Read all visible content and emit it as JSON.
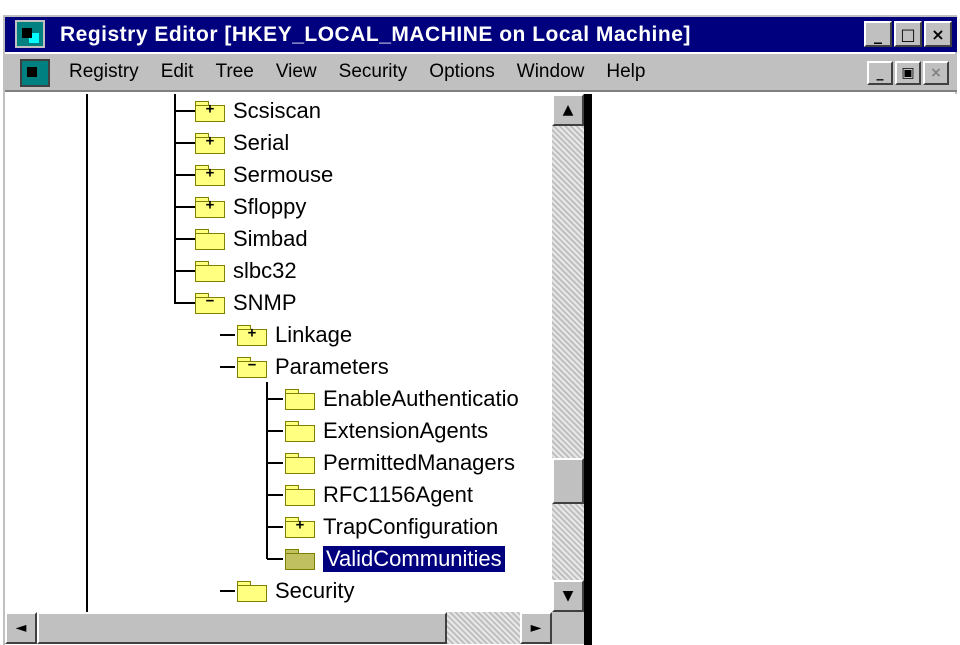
{
  "window": {
    "title": "Registry Editor   [HKEY_LOCAL_MACHINE on Local Machine]",
    "caption_buttons": {
      "minimize": "_",
      "maximize": "□",
      "close": "×"
    }
  },
  "menu": {
    "items": [
      "Registry",
      "Edit",
      "Tree",
      "View",
      "Security",
      "Options",
      "Window",
      "Help"
    ],
    "mdi_buttons": {
      "minimize": "_",
      "restore": "▣",
      "close": "×"
    }
  },
  "tree": {
    "nodes": [
      {
        "label": "Scsiscan",
        "glyph": "+"
      },
      {
        "label": "Serial",
        "glyph": "+"
      },
      {
        "label": "Sermouse",
        "glyph": "+"
      },
      {
        "label": "Sfloppy",
        "glyph": "+"
      },
      {
        "label": "Simbad",
        "glyph": ""
      },
      {
        "label": "slbc32",
        "glyph": ""
      },
      {
        "label": "SNMP",
        "glyph": "−"
      },
      {
        "label": "Linkage",
        "glyph": "+"
      },
      {
        "label": "Parameters",
        "glyph": "−"
      },
      {
        "label": "EnableAuthenticatio",
        "glyph": ""
      },
      {
        "label": "ExtensionAgents",
        "glyph": ""
      },
      {
        "label": "PermittedManagers",
        "glyph": ""
      },
      {
        "label": "RFC1156Agent",
        "glyph": ""
      },
      {
        "label": "TrapConfiguration",
        "glyph": "+"
      },
      {
        "label": "ValidCommunities",
        "glyph": "",
        "selected": true
      },
      {
        "label": "Security",
        "glyph": ""
      }
    ]
  },
  "scrollbars": {
    "up": "▲",
    "down": "▼",
    "left": "◄",
    "right": "►"
  },
  "colors": {
    "titlebar": "#00007f",
    "selection": "#00007f",
    "chrome": "#c0c0c0",
    "folder": "#ffff80"
  }
}
